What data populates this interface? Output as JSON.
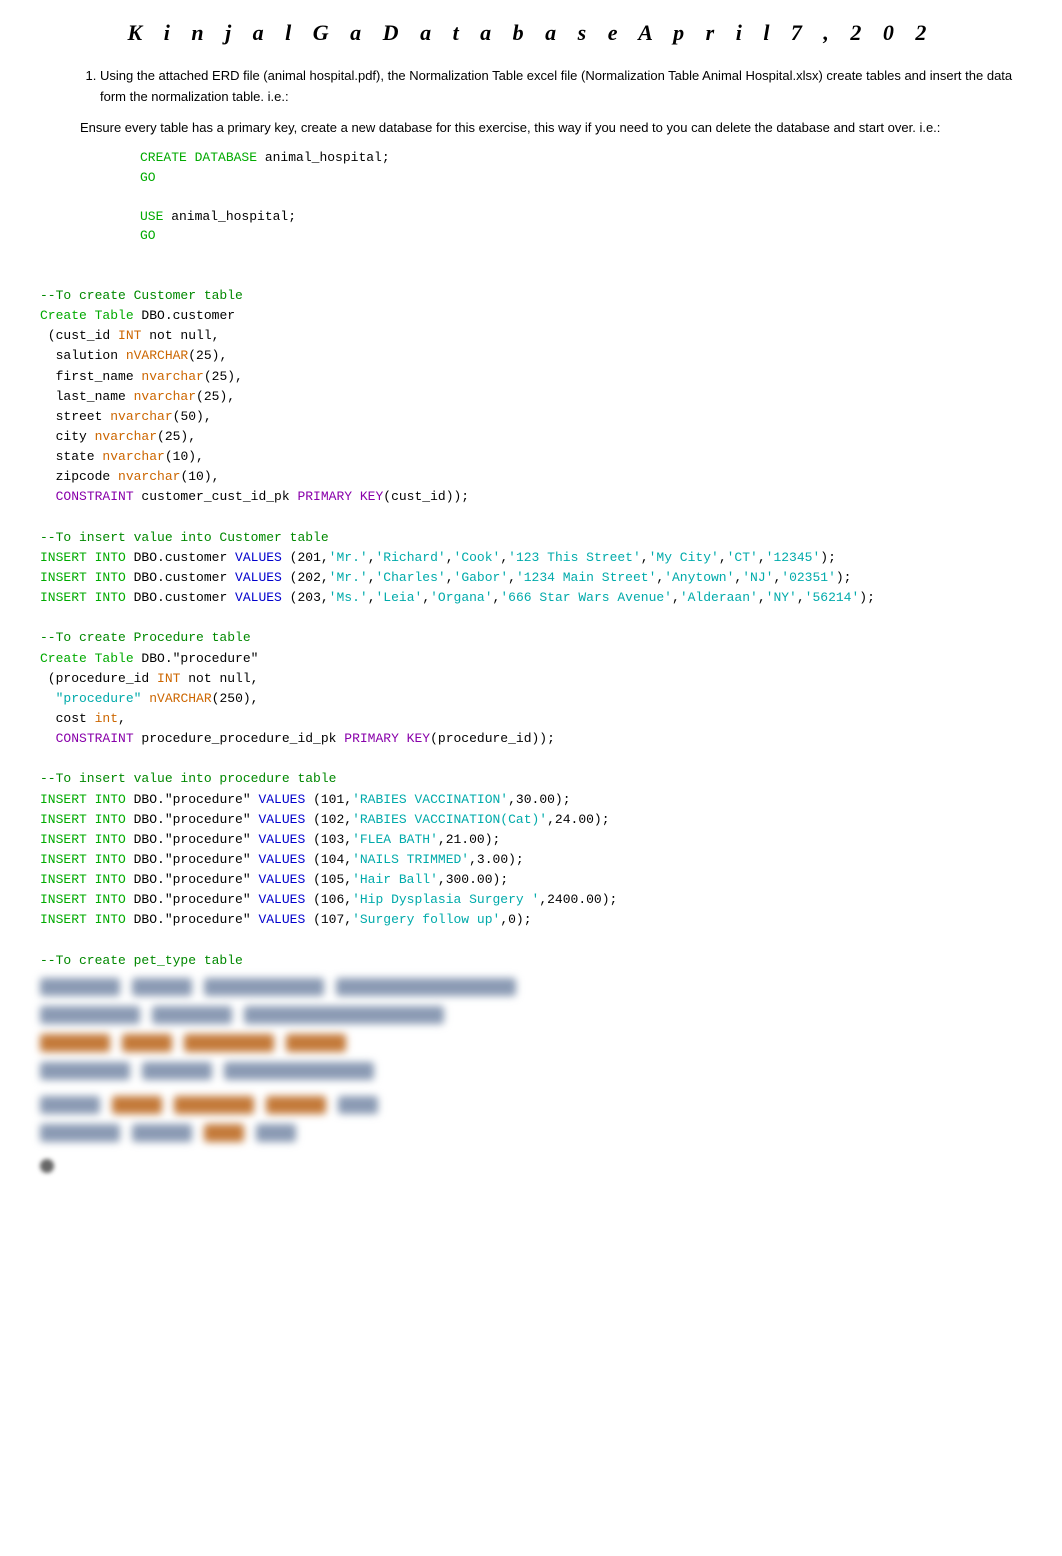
{
  "header": {
    "title": "K i n j a l   G a D a t a b a s e   A p r i l   7 ,   2 0 2"
  },
  "intro": {
    "item1": "Using the attached ERD file (animal hospital.pdf), the Normalization Table excel file (Normalization Table Animal Hospital.xlsx) create tables and insert the data form the normalization table. i.e.:",
    "para2": "Ensure every table has a primary key, create a new database for this exercise, this way if you need to you can delete the database and start over. i.e.:"
  },
  "code": {
    "create_db": "CREATE DATABASE animal_hospital;",
    "go1": "GO",
    "use_db": "USE animal_hospital;",
    "go2": "GO"
  },
  "sql": {
    "comment_customer_table": "--To create Customer table",
    "comment_insert_customer": "--To insert value into Customer table",
    "comment_procedure_table": "--To create Procedure table",
    "comment_insert_procedure": "--To insert value into procedure table",
    "comment_pet_type": "--To create pet_type table"
  }
}
